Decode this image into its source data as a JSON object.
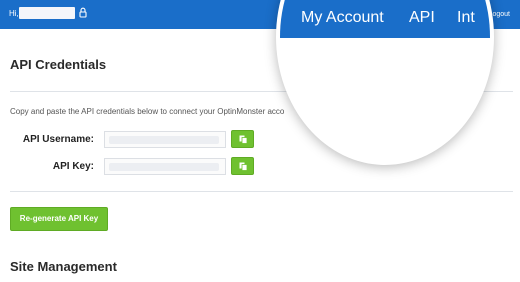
{
  "header": {
    "greeting": "Hi,",
    "logout_label": "Logout"
  },
  "magnifier": {
    "nav_items": [
      "My Account",
      "API",
      "Int"
    ]
  },
  "credentials": {
    "title": "API Credentials",
    "instructions": "Copy and paste the API credentials below to connect your OptinMonster acco",
    "username_label": "API Username:",
    "key_label": "API Key:",
    "regenerate_label": "Re-generate API Key"
  },
  "site_management": {
    "title": "Site Management"
  },
  "colors": {
    "brand_blue": "#1a6ec9",
    "action_green": "#6fc130"
  },
  "icons": {
    "lock": "lock-icon",
    "logout": "power-icon",
    "copy": "copy-icon"
  }
}
